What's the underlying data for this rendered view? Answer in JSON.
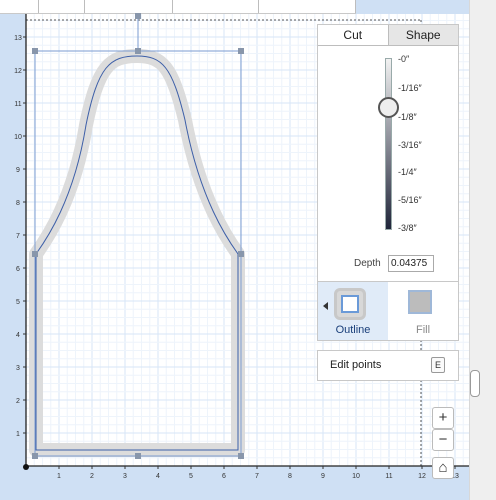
{
  "toolbar": {
    "icons": [
      "tool-icon",
      "help-icon",
      "shape-icon",
      "import-icon",
      "select-icon"
    ]
  },
  "ruler": {
    "x_ticks": [
      "1",
      "2",
      "3",
      "4",
      "5",
      "6",
      "7",
      "8",
      "9",
      "10",
      "11",
      "12",
      "13"
    ],
    "y_ticks": [
      "13",
      "12",
      "11",
      "10",
      "9",
      "8",
      "7",
      "6",
      "5",
      "4",
      "3",
      "2",
      "1"
    ]
  },
  "panel": {
    "tabs": [
      {
        "label": "Cut",
        "active": true
      },
      {
        "label": "Shape",
        "active": false
      }
    ],
    "depth_marks": [
      "-0″",
      "-1/16″",
      "-1/8″",
      "-3/16″",
      "-1/4″",
      "-5/16″",
      "-3/8″"
    ],
    "depth_label": "Depth",
    "depth_value": "0.04375",
    "modes": [
      {
        "label": "Outline",
        "icon": "outline-icon",
        "active": true
      },
      {
        "label": "Fill",
        "icon": "fill-icon",
        "active": false
      }
    ]
  },
  "edit_points": {
    "label": "Edit points",
    "shortcut": "E"
  },
  "zoom": {
    "in": "+",
    "out": "−",
    "home": "⌂"
  },
  "colors": {
    "grid": "#d7e6f7",
    "selection": "#7b9bd0",
    "handle": "#8896ab",
    "cut_shadow": "#dcdcdc"
  }
}
